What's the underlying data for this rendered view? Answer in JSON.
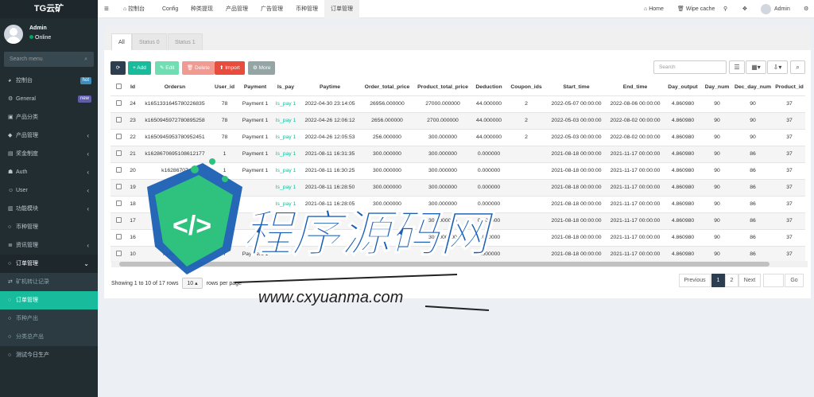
{
  "sidebar": {
    "brand": "TG云矿",
    "user": {
      "name": "Admin",
      "status": "Online"
    },
    "search_placeholder": "Search menu",
    "items": [
      {
        "label": "控制台",
        "icon": "dashboard-icon",
        "badge": "hot",
        "badge_color": "#3c8dbc"
      },
      {
        "label": "General",
        "icon": "cogs-icon",
        "badge": "new",
        "badge_color": "#605ca8"
      },
      {
        "label": "产品分类",
        "icon": "category-icon"
      },
      {
        "label": "产品管理",
        "icon": "diamond-icon",
        "chevron": "‹"
      },
      {
        "label": "奖金制度",
        "icon": "money-icon",
        "chevron": "‹"
      },
      {
        "label": "Auth",
        "icon": "group-icon",
        "chevron": "‹"
      },
      {
        "label": "User",
        "icon": "user-icon",
        "chevron": "‹"
      },
      {
        "label": "功能模块",
        "icon": "module-icon",
        "chevron": "‹"
      },
      {
        "label": "币种管理",
        "icon": "circle-icon"
      },
      {
        "label": "资讯管理",
        "icon": "list-icon",
        "chevron": "‹"
      },
      {
        "label": "订单管理",
        "icon": "circle-icon",
        "chevron": "⌄"
      }
    ],
    "sub_items": [
      {
        "label": "矿机转让记录",
        "icon": "transfer-icon"
      },
      {
        "label": "订单管理",
        "icon": "circle-icon",
        "active": true
      },
      {
        "label": "币种产出",
        "icon": "circle-icon"
      },
      {
        "label": "分类总产出",
        "icon": "circle-icon"
      }
    ],
    "last_item": {
      "label": "测试今日生产",
      "icon": "circle-icon"
    }
  },
  "topbar": {
    "tabs": [
      "控制台",
      "Config",
      "种类提现",
      "产品管理",
      "广告管理",
      "币种管理",
      "订单管理"
    ],
    "right": {
      "home": "Home",
      "wipe": "Wipe cache",
      "admin": "Admin"
    }
  },
  "filters": [
    "All",
    "Status 0",
    "Status 1"
  ],
  "toolbar": {
    "refresh": "⟳",
    "add": "+ Add",
    "edit": "✎ Edit",
    "delete": "🗑 Delete",
    "import": "⬆ Import",
    "more": "⚙ More",
    "search_placeholder": "Search"
  },
  "colors": {
    "accent": "#18bc9c",
    "add": "#18bc9c",
    "edit": "#6fdfb3",
    "delete": "#f09a92",
    "import": "#e74c3c",
    "more": "#95a5a6",
    "dark": "#2c3e50"
  },
  "table": {
    "columns": [
      "Id",
      "Ordersn",
      "User_id",
      "Payment",
      "Is_pay",
      "Paytime",
      "Order_total_price",
      "Product_total_price",
      "Deduction",
      "Coupon_ids",
      "Start_time",
      "End_time",
      "Day_output",
      "Day_num",
      "Dec_day_num",
      "Product_id"
    ],
    "rows": [
      [
        "24",
        "k1651331645780226835",
        "78",
        "Payment 1",
        "Is_pay 1",
        "2022-04-30 23:14:05",
        "26956.000000",
        "27000.000000",
        "44.000000",
        "2",
        "2022-05-07 00:00:00",
        "2022-08-06 00:00:00",
        "4.860980",
        "90",
        "90",
        "37"
      ],
      [
        "23",
        "k1650945972780895258",
        "78",
        "Payment 1",
        "Is_pay 1",
        "2022-04-26 12:06:12",
        "2656.000000",
        "2700.000000",
        "44.000000",
        "2",
        "2022-05-03 00:00:00",
        "2022-08-02 00:00:00",
        "4.860980",
        "90",
        "90",
        "37"
      ],
      [
        "22",
        "k1650945953780952451",
        "78",
        "Payment 1",
        "Is_pay 1",
        "2022-04-26 12:05:53",
        "256.000000",
        "300.000000",
        "44.000000",
        "2",
        "2022-05-03 00:00:00",
        "2022-08-02 00:00:00",
        "4.860980",
        "90",
        "90",
        "37"
      ],
      [
        "21",
        "k1628670695108612177",
        "1",
        "Payment 1",
        "Is_pay 1",
        "2021-08-11 16:31:35",
        "300.000000",
        "300.000000",
        "0.000000",
        "",
        "2021-08-18 00:00:00",
        "2021-11-17 00:00:00",
        "4.860980",
        "90",
        "86",
        "37"
      ],
      [
        "20",
        "k16286707",
        "1",
        "Payment 1",
        "Is_pay 1",
        "2021-08-11 16:30:25",
        "300.000000",
        "300.000000",
        "0.000000",
        "",
        "2021-08-18 00:00:00",
        "2021-11-17 00:00:00",
        "4.860980",
        "90",
        "86",
        "37"
      ],
      [
        "19",
        "",
        "",
        "",
        "Is_pay 1",
        "2021-08-11 16:28:50",
        "300.000000",
        "300.000000",
        "0.000000",
        "",
        "2021-08-18 00:00:00",
        "2021-11-17 00:00:00",
        "4.860980",
        "90",
        "86",
        "37"
      ],
      [
        "18",
        "",
        "",
        "",
        "Is_pay 1",
        "2021-08-11 16:28:05",
        "300.000000",
        "300.000000",
        "0.000000",
        "",
        "2021-08-18 00:00:00",
        "2021-11-17 00:00:00",
        "4.860980",
        "90",
        "86",
        "37"
      ],
      [
        "17",
        "",
        "",
        "",
        "",
        "",
        "",
        "300.000000",
        "0.000000",
        "",
        "2021-08-18 00:00:00",
        "2021-11-17 00:00:00",
        "4.860980",
        "90",
        "86",
        "37"
      ],
      [
        "16",
        "k162",
        "7",
        "",
        "",
        "",
        "",
        "300.000000",
        "0.000000",
        "",
        "2021-08-18 00:00:00",
        "2021-11-17 00:00:00",
        "4.860980",
        "90",
        "86",
        "37"
      ],
      [
        "10",
        "k1628668",
        "7",
        "Payment 1",
        "",
        "",
        "",
        "",
        "0.000000",
        "",
        "2021-08-18 00:00:00",
        "2021-11-17 00:00:00",
        "4.860980",
        "90",
        "86",
        "37"
      ]
    ]
  },
  "footer": {
    "showing": "Showing 1 to 10 of 17 rows",
    "page_size": "10 ▴",
    "per_page": "rows per page",
    "previous": "Previous",
    "pages": [
      "1",
      "2"
    ],
    "next": "Next",
    "go": "Go"
  },
  "watermark": {
    "big": "程序源码网",
    "url": "www.cxyuanma.com"
  }
}
